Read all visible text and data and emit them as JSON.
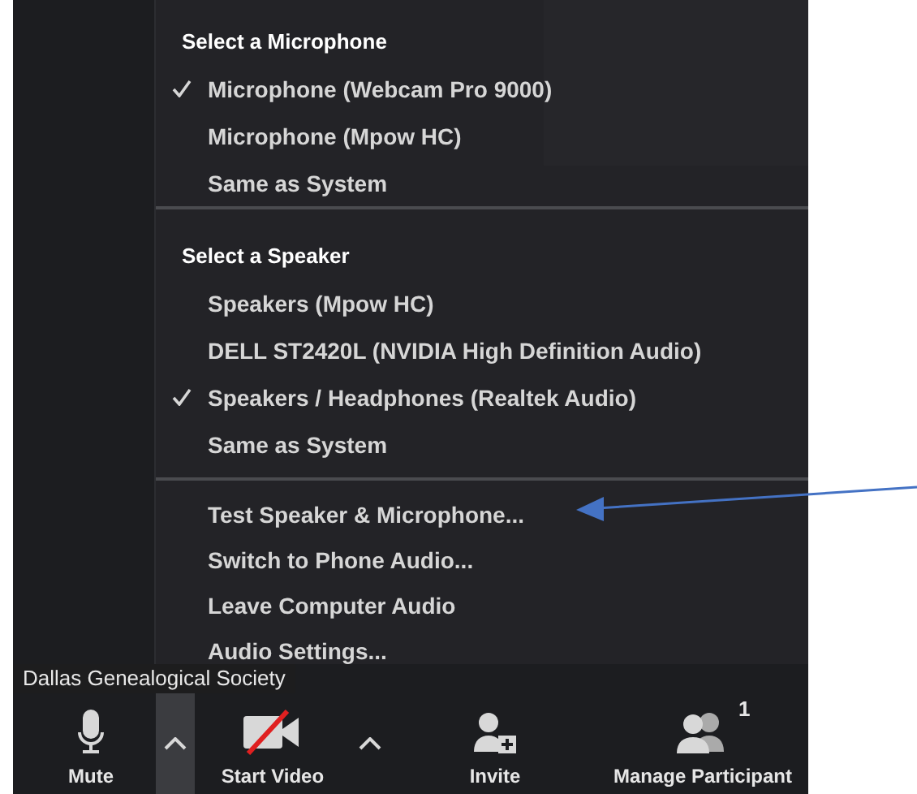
{
  "menu": {
    "sections": [
      {
        "heading": "Select a Microphone",
        "items": [
          {
            "label": "Microphone (Webcam Pro 9000)",
            "checked": true
          },
          {
            "label": "Microphone (Mpow HC)",
            "checked": false
          },
          {
            "label": "Same as System",
            "checked": false
          }
        ]
      },
      {
        "heading": "Select a Speaker",
        "items": [
          {
            "label": "Speakers (Mpow HC)",
            "checked": false
          },
          {
            "label": "DELL ST2420L (NVIDIA High Definition Audio)",
            "checked": false
          },
          {
            "label": "Speakers / Headphones (Realtek Audio)",
            "checked": true
          },
          {
            "label": "Same as System",
            "checked": false
          }
        ]
      }
    ],
    "actions": [
      "Test Speaker & Microphone...",
      "Switch to Phone Audio...",
      "Leave Computer Audio",
      "Audio Settings..."
    ]
  },
  "name_label": "Dallas Genealogical Society",
  "toolbar": [
    {
      "kind": "mute",
      "label": "Mute"
    },
    {
      "kind": "caret",
      "selected": true
    },
    {
      "kind": "video",
      "label": "Start Video"
    },
    {
      "kind": "caret",
      "selected": false
    },
    {
      "kind": "invite",
      "label": "Invite"
    },
    {
      "kind": "participants",
      "label": "Manage Participant",
      "count": "1"
    }
  ]
}
